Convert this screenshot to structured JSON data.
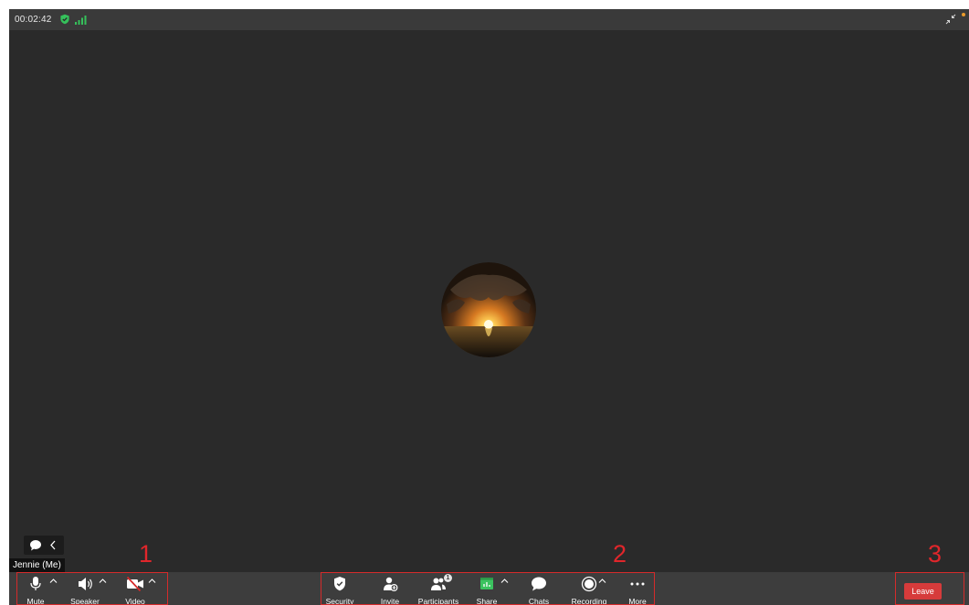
{
  "meeting": {
    "timer": "00:02:42",
    "participant_name": "Jennie (Me)"
  },
  "icons": {
    "encryption": "shield-check-icon",
    "connection": "signal-bars-icon",
    "exit_fullscreen": "arrows-in-icon",
    "chat_panel": "chat-bubble-icon"
  },
  "colors": {
    "background": "#2a2a2a",
    "toolbar": "#3d3d3d",
    "secure_green": "#35c15b",
    "share_green": "#3bc35f",
    "leave_red": "#d63b3b",
    "annotation_red": "#e0262b"
  },
  "toolbar": {
    "left": [
      {
        "key": "mute",
        "label": "Mute",
        "icon": "microphone-icon"
      },
      {
        "key": "speaker",
        "label": "Speaker",
        "icon": "speaker-icon"
      },
      {
        "key": "video",
        "label": "Video",
        "icon": "video-off-icon"
      }
    ],
    "center": [
      {
        "key": "security",
        "label": "Security",
        "icon": "security-shield-icon"
      },
      {
        "key": "invite",
        "label": "Invite",
        "icon": "add-person-icon"
      },
      {
        "key": "participants",
        "label": "Participants",
        "icon": "participants-icon"
      },
      {
        "key": "share",
        "label": "Share",
        "icon": "share-screen-icon"
      },
      {
        "key": "chats",
        "label": "Chats",
        "icon": "chat-icon"
      },
      {
        "key": "recording",
        "label": "Recording",
        "icon": "record-icon"
      },
      {
        "key": "more",
        "label": "More",
        "icon": "ellipsis-icon"
      }
    ],
    "participants_count": "1",
    "leave_label": "Leave"
  },
  "annotations": {
    "group_1": "1",
    "group_2": "2",
    "group_3": "3"
  }
}
